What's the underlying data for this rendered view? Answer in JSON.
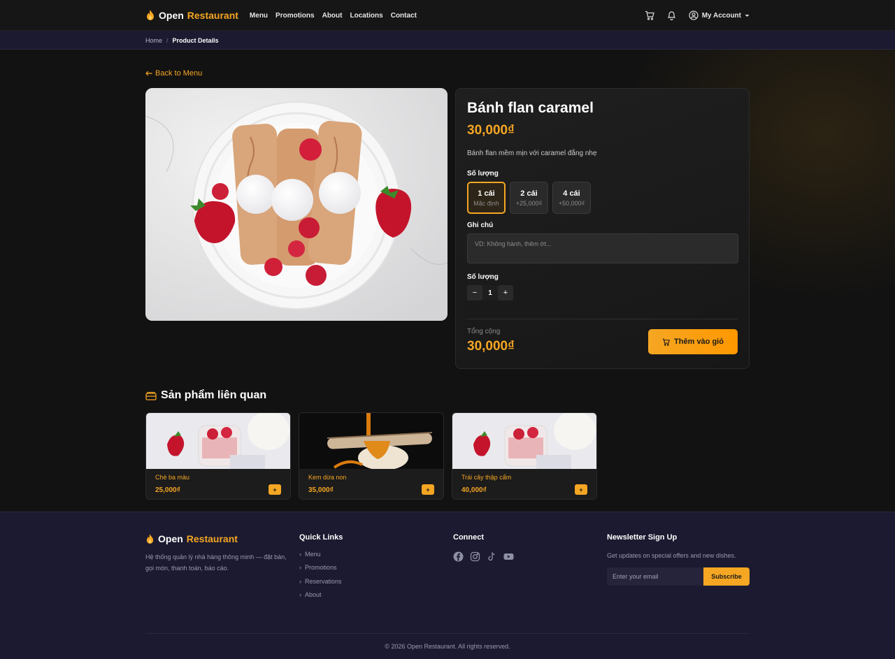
{
  "brand": {
    "name_part1": "Open",
    "name_part2": "Restaurant",
    "accent": "#f5a623"
  },
  "nav": {
    "items": [
      "Menu",
      "Promotions",
      "About",
      "Locations",
      "Contact"
    ]
  },
  "header": {
    "account_label": "My Account",
    "icons": [
      "cart-icon",
      "bell-icon",
      "user-circle-icon",
      "caret-down-icon"
    ]
  },
  "breadcrumb": {
    "home": "Home",
    "separator": "/",
    "current": "Product Details"
  },
  "back_link": "Back to Menu",
  "product": {
    "title": "Bánh flan caramel",
    "price": "30,000₫",
    "description": "Bánh flan mềm mịn với caramel đắng nhẹ",
    "size_label": "Số lượng",
    "options": [
      {
        "label": "1 cái",
        "sub": "Mặc định",
        "selected": true
      },
      {
        "label": "2 cái",
        "sub": "+25,000₫",
        "selected": false
      },
      {
        "label": "4 cái",
        "sub": "+50,000₫",
        "selected": false
      }
    ],
    "note_label": "Ghi chú",
    "note_placeholder": "VD: Không hành, thêm ớt...",
    "note_value": "",
    "qty_label": "Số lượng",
    "qty_minus": "−",
    "qty_value": "1",
    "qty_plus": "+",
    "total_label": "Tổng cộng",
    "total_price": "30,000₫",
    "add_button": "Thêm vào giỏ"
  },
  "related": {
    "title": "Sản phẩm liên quan",
    "items": [
      {
        "name": "Chè ba màu",
        "price": "25,000₫",
        "add": "+"
      },
      {
        "name": "Kem dừa non",
        "price": "35,000₫",
        "add": "+"
      },
      {
        "name": "Trái cây thập cẩm",
        "price": "40,000₫",
        "add": "+"
      }
    ]
  },
  "footer": {
    "description": "Hệ thống quản lý nhà hàng thông minh — đặt bàn, gọi món, thanh toán, báo cáo.",
    "quick_links_title": "Quick Links",
    "quick_links": [
      "Menu",
      "Promotions",
      "Reservations",
      "About"
    ],
    "connect_title": "Connect",
    "social": [
      "facebook-icon",
      "instagram-icon",
      "tiktok-icon",
      "youtube-icon"
    ],
    "newsletter_title": "Newsletter Sign Up",
    "newsletter_desc": "Get updates on special offers and new dishes.",
    "email_placeholder": "Enter your email",
    "subscribe": "Subscribe",
    "copyright": "© 2026 Open Restaurant. All rights reserved."
  }
}
